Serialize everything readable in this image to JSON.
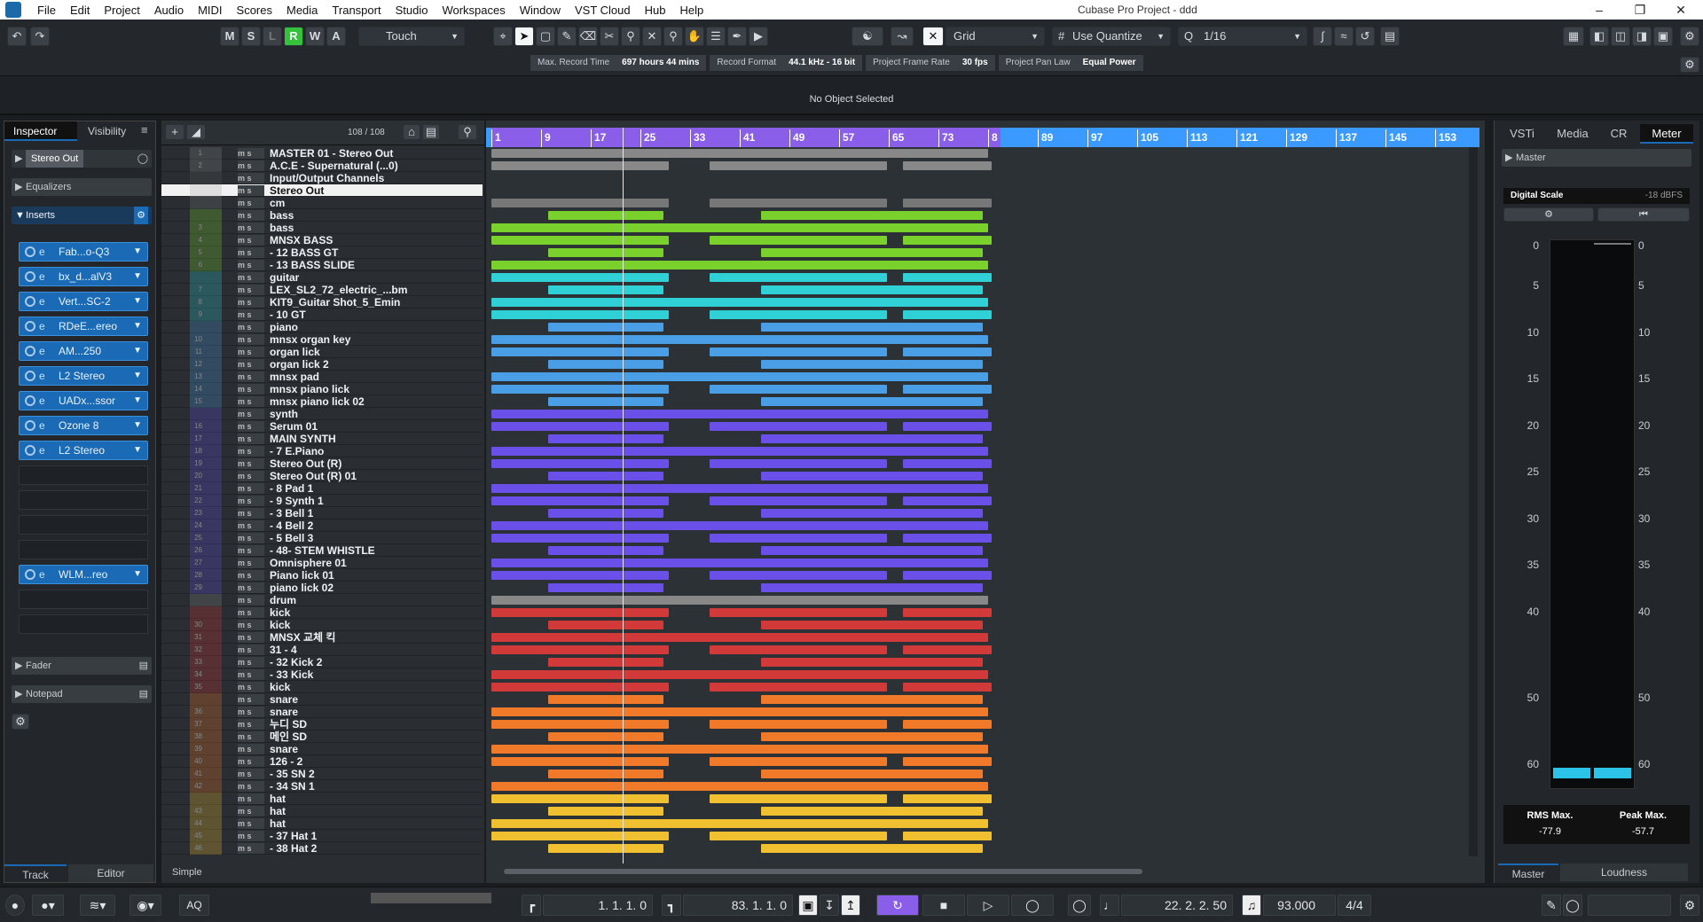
{
  "app": {
    "title": "Cubase Pro Project - ddd",
    "accent": "#1a6ab5"
  },
  "menu": [
    "File",
    "Edit",
    "Project",
    "Audio",
    "MIDI",
    "Scores",
    "Media",
    "Transport",
    "Studio",
    "Workspaces",
    "Window",
    "VST Cloud",
    "Hub",
    "Help"
  ],
  "toolbar": {
    "ms_buttons": [
      "M",
      "S",
      "L",
      "R",
      "W",
      "A"
    ],
    "automation_mode": "Touch",
    "snap_type": "Grid",
    "quantize_mode": "Use Quantize",
    "quantize_value": "1/16"
  },
  "info": {
    "max_record_label": "Max. Record Time",
    "max_record_value": "697 hours 44 mins",
    "record_format_label": "Record Format",
    "record_format_value": "44.1 kHz - 16 bit",
    "frame_rate_label": "Project Frame Rate",
    "frame_rate_value": "30 fps",
    "pan_law_label": "Project Pan Law",
    "pan_law_value": "Equal Power",
    "status": "No Object Selected"
  },
  "inspector": {
    "tabs": [
      "Inspector",
      "Visibility"
    ],
    "output": "Stereo Out",
    "equalizers": "Equalizers",
    "inserts": "Inserts",
    "insert_slots": [
      "Fab...o-Q3",
      "bx_d...alV3",
      "Vert...SC-2",
      "RDeE...ereo",
      "AM...250",
      "L2 Stereo",
      "UADx...ssor",
      "Ozone 8",
      "L2 Stereo",
      "WLM...reo"
    ],
    "fader": "Fader",
    "notepad": "Notepad",
    "bottom_tabs": [
      "Track",
      "Editor"
    ]
  },
  "tracklist": {
    "count": "108 / 108",
    "footer": "Simple",
    "tracks": [
      {
        "n": "1",
        "name": "MASTER 01 - Stereo Out",
        "color": "#888888"
      },
      {
        "n": "2",
        "name": "A.C.E - Supernatural (...0)",
        "color": "#888888"
      },
      {
        "n": "",
        "name": "Input/Output Channels",
        "color": "#555555"
      },
      {
        "n": "",
        "name": "Stereo Out",
        "color": "#aaaaaa"
      },
      {
        "n": "",
        "name": "cm",
        "color": "#777777"
      },
      {
        "n": "",
        "name": "bass",
        "color": "#7bd12c"
      },
      {
        "n": "3",
        "name": "bass",
        "color": "#7bd12c"
      },
      {
        "n": "4",
        "name": "MNSX BASS",
        "color": "#7bd12c"
      },
      {
        "n": "5",
        "name": "- 12 BASS GT",
        "color": "#7bd12c"
      },
      {
        "n": "6",
        "name": "- 13 BASS SLIDE",
        "color": "#7bd12c"
      },
      {
        "n": "",
        "name": "guitar",
        "color": "#2fd0d6"
      },
      {
        "n": "7",
        "name": "LEX_SL2_72_electric_...bm",
        "color": "#2fd0d6"
      },
      {
        "n": "8",
        "name": "KIT9_Guitar Shot_5_Emin",
        "color": "#2fd0d6"
      },
      {
        "n": "9",
        "name": "- 10 GT",
        "color": "#2fd0d6"
      },
      {
        "n": "",
        "name": "piano",
        "color": "#4a9ee6"
      },
      {
        "n": "10",
        "name": "mnsx organ key",
        "color": "#4a9ee6"
      },
      {
        "n": "11",
        "name": "organ lick",
        "color": "#4a9ee6"
      },
      {
        "n": "12",
        "name": "organ lick 2",
        "color": "#4a9ee6"
      },
      {
        "n": "13",
        "name": "mnsx pad",
        "color": "#4a9ee6"
      },
      {
        "n": "14",
        "name": "mnsx piano lick",
        "color": "#4a9ee6"
      },
      {
        "n": "15",
        "name": "mnsx piano lick 02",
        "color": "#4a9ee6"
      },
      {
        "n": "",
        "name": "synth",
        "color": "#6a4fe8"
      },
      {
        "n": "16",
        "name": "Serum 01",
        "color": "#6a4fe8"
      },
      {
        "n": "17",
        "name": "MAIN SYNTH",
        "color": "#6a4fe8"
      },
      {
        "n": "18",
        "name": "- 7 E.Piano",
        "color": "#6a4fe8"
      },
      {
        "n": "19",
        "name": "Stereo Out (R)",
        "color": "#6a4fe8"
      },
      {
        "n": "20",
        "name": "Stereo Out (R) 01",
        "color": "#6a4fe8"
      },
      {
        "n": "21",
        "name": "- 8 Pad 1",
        "color": "#6a4fe8"
      },
      {
        "n": "22",
        "name": "- 9 Synth 1",
        "color": "#6a4fe8"
      },
      {
        "n": "23",
        "name": "- 3 Bell 1",
        "color": "#6a4fe8"
      },
      {
        "n": "24",
        "name": "- 4 Bell 2",
        "color": "#6a4fe8"
      },
      {
        "n": "25",
        "name": "- 5 Bell 3",
        "color": "#6a4fe8"
      },
      {
        "n": "26",
        "name": "- 48- STEM WHISTLE",
        "color": "#6a4fe8"
      },
      {
        "n": "27",
        "name": "Omnisphere 01",
        "color": "#6a4fe8"
      },
      {
        "n": "28",
        "name": "Piano lick 01",
        "color": "#6a4fe8"
      },
      {
        "n": "29",
        "name": "piano lick 02",
        "color": "#6a4fe8"
      },
      {
        "n": "",
        "name": "drum",
        "color": "#888888"
      },
      {
        "n": "",
        "name": "kick",
        "color": "#d23a3a"
      },
      {
        "n": "30",
        "name": "kick",
        "color": "#d23a3a"
      },
      {
        "n": "31",
        "name": "MNSX 교체 킥",
        "color": "#d23a3a"
      },
      {
        "n": "32",
        "name": "31 - 4",
        "color": "#d23a3a"
      },
      {
        "n": "33",
        "name": "- 32 Kick 2",
        "color": "#d23a3a"
      },
      {
        "n": "34",
        "name": "- 33 Kick",
        "color": "#d23a3a"
      },
      {
        "n": "35",
        "name": "kick",
        "color": "#d23a3a"
      },
      {
        "n": "",
        "name": "snare",
        "color": "#f07a2a"
      },
      {
        "n": "36",
        "name": "snare",
        "color": "#f07a2a"
      },
      {
        "n": "37",
        "name": "누디 SD",
        "color": "#f07a2a"
      },
      {
        "n": "38",
        "name": "메인 SD",
        "color": "#f07a2a"
      },
      {
        "n": "39",
        "name": "snare",
        "color": "#f07a2a"
      },
      {
        "n": "40",
        "name": "126 - 2",
        "color": "#f07a2a"
      },
      {
        "n": "41",
        "name": "- 35 SN 2",
        "color": "#f07a2a"
      },
      {
        "n": "42",
        "name": "- 34 SN 1",
        "color": "#f07a2a"
      },
      {
        "n": "",
        "name": "hat",
        "color": "#f0c030"
      },
      {
        "n": "43",
        "name": "hat",
        "color": "#f0c030"
      },
      {
        "n": "44",
        "name": "hat",
        "color": "#f0c030"
      },
      {
        "n": "45",
        "name": "- 37 Hat 1",
        "color": "#f0c030"
      },
      {
        "n": "46",
        "name": "- 38 Hat 2",
        "color": "#f0c030"
      }
    ]
  },
  "ruler": [
    "1",
    "9",
    "17",
    "25",
    "33",
    "41",
    "49",
    "57",
    "65",
    "73",
    "8",
    "89",
    "97",
    "105",
    "113",
    "121",
    "129",
    "137",
    "145",
    "153"
  ],
  "right": {
    "tabs": [
      "VSTi",
      "Media",
      "CR",
      "Meter"
    ],
    "master": "Master",
    "scale_label": "Digital Scale",
    "scale_value": "-18 dBFS",
    "scale_marks": [
      "0",
      "5",
      "10",
      "15",
      "20",
      "25",
      "30",
      "35",
      "40",
      "50",
      "60"
    ],
    "rms_label": "RMS Max.",
    "rms_value": "-77.9",
    "peak_label": "Peak Max.",
    "peak_value": "-57.7",
    "bottom_tabs": [
      "Master",
      "Loudness"
    ]
  },
  "transport": {
    "left_locator": "1. 1. 1.   0",
    "right_locator": "83. 1. 1.   0",
    "position": "22. 2. 2. 50",
    "tempo": "93.000",
    "signature": "4/4",
    "aq": "AQ"
  }
}
